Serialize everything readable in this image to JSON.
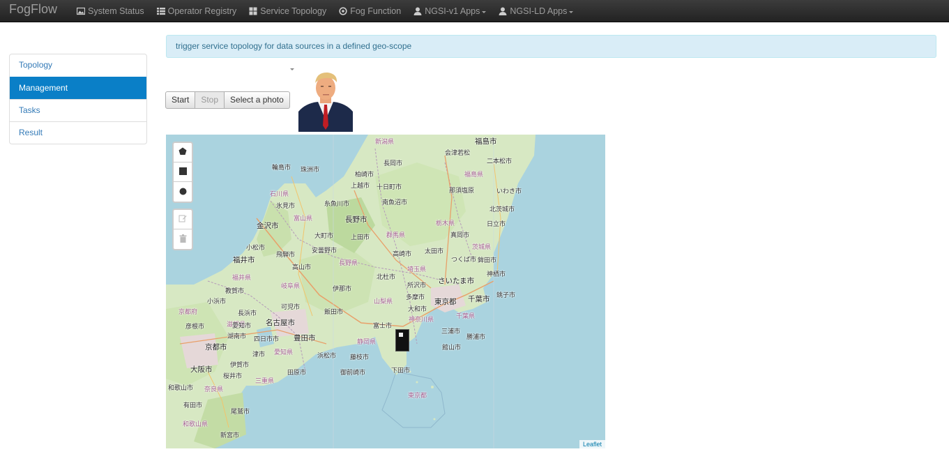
{
  "navbar": {
    "brand": "FogFlow",
    "items": [
      {
        "label": "System Status",
        "icon": "picture-icon"
      },
      {
        "label": "Operator Registry",
        "icon": "list-icon"
      },
      {
        "label": "Service Topology",
        "icon": "grid-icon"
      },
      {
        "label": "Fog Function",
        "icon": "circle-dot-icon"
      },
      {
        "label": "NGSI-v1 Apps",
        "icon": "user-icon",
        "dropdown": true
      },
      {
        "label": "NGSI-LD Apps",
        "icon": "user-icon",
        "dropdown": true
      }
    ]
  },
  "sidebar": {
    "items": [
      {
        "label": "Topology",
        "active": false
      },
      {
        "label": "Management",
        "active": true
      },
      {
        "label": "Tasks",
        "active": false
      },
      {
        "label": "Result",
        "active": false
      }
    ]
  },
  "alert": {
    "text": "trigger service topology for data sources in a defined geo-scope"
  },
  "buttons": {
    "start": "Start",
    "stop": "Stop",
    "select_photo": "Select a photo"
  },
  "map": {
    "attribution": "Leaflet",
    "draw_tools": [
      "pentagon-icon",
      "square-icon",
      "circle-icon"
    ],
    "edit_tools": [
      "edit-icon",
      "trash-icon"
    ],
    "labels": [
      "福島市",
      "会津若松",
      "二本松市",
      "新潟県",
      "長岡市",
      "輪島市",
      "珠洲市",
      "柏崎市",
      "十日町市",
      "上越市",
      "福島県",
      "那須塩原",
      "いわき市",
      "石川県",
      "氷見市",
      "糸魚川市",
      "南魚沼市",
      "北茨城市",
      "金沢市",
      "富山県",
      "長野市",
      "栃木県",
      "日立市",
      "大町市",
      "上田市",
      "群馬県",
      "真岡市",
      "小松市",
      "安曇野市",
      "茨城県",
      "福井市",
      "飛騨市",
      "太田市",
      "高崎市",
      "つくば市",
      "鉾田市",
      "高山市",
      "長野県",
      "埼玉県",
      "神栖市",
      "福井県",
      "北杜市",
      "さいたま市",
      "所沢市",
      "岐阜県",
      "伊那市",
      "多摩市",
      "教賀市",
      "東京都",
      "千葉市",
      "銚子市",
      "小浜市",
      "可児市",
      "大和市",
      "長浜市",
      "山梨県",
      "飯田市",
      "京都府",
      "滋賀県",
      "名古屋市",
      "神奈川県",
      "千葉県",
      "彦根市",
      "富士市",
      "湖南市",
      "三浦市",
      "勝浦市",
      "四日市市",
      "豊田市",
      "静岡県",
      "京都市",
      "館山市",
      "津市",
      "浜松市",
      "藤枝市",
      "大阪市",
      "愛知県",
      "伊賀市",
      "三重県",
      "田原市",
      "御前崎市",
      "下田市",
      "桜井市",
      "和歌山市",
      "奈良県",
      "有田市",
      "尾鷲市",
      "和歌山県",
      "新宮市",
      "東京都",
      "愛知市"
    ]
  }
}
